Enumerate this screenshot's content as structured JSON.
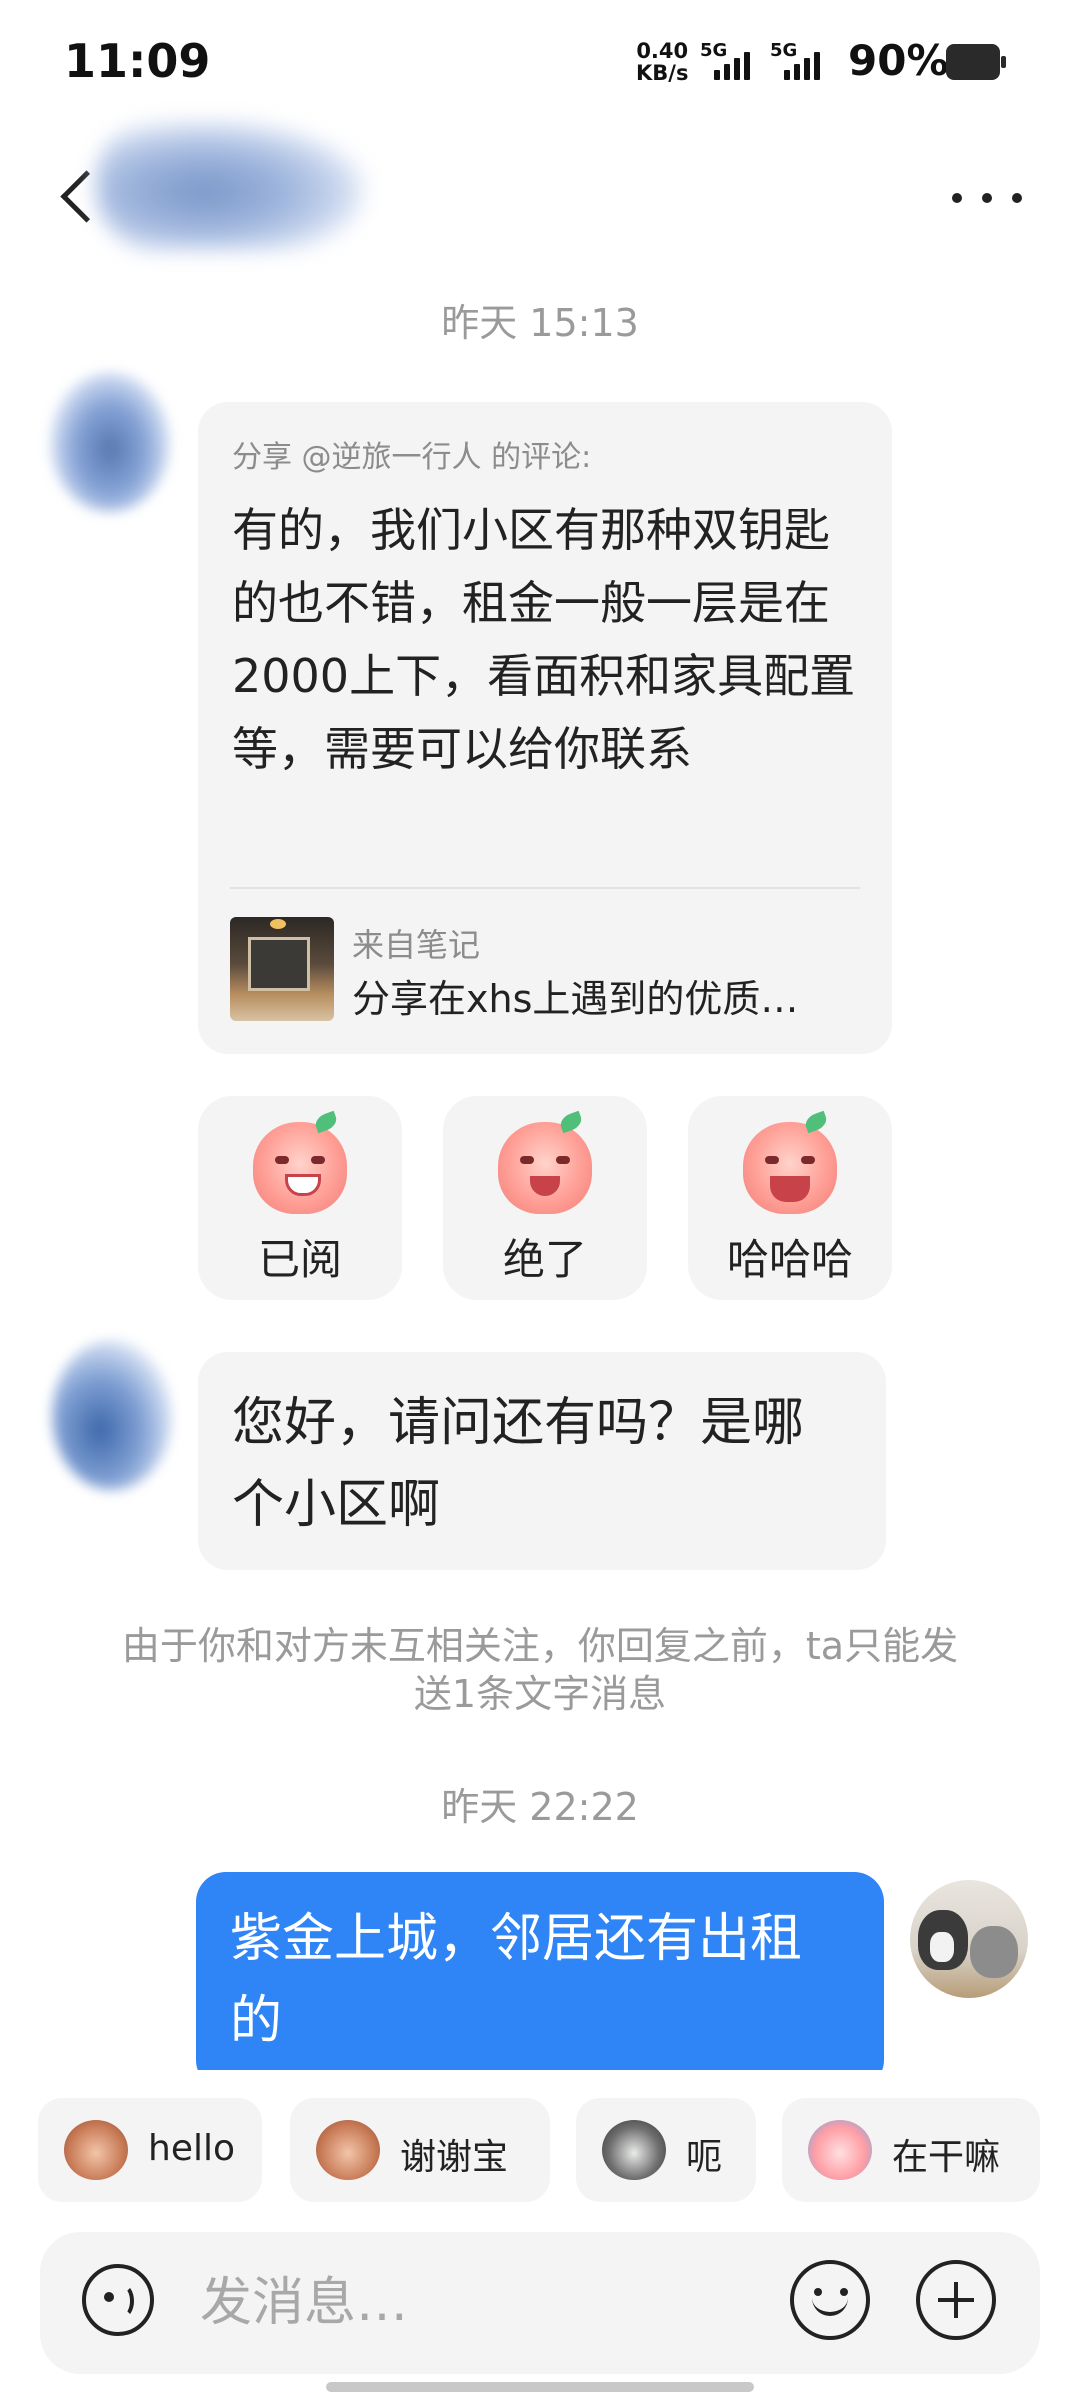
{
  "status_bar": {
    "time": "11:09",
    "net_speed_value": "0.40",
    "net_speed_unit": "KB/s",
    "signal1_label": "5G",
    "signal2_label": "5G",
    "battery_percent": "90%"
  },
  "header": {
    "back_icon": "chevron-left-icon",
    "more_icon": "more-horizontal-icon"
  },
  "messages": {
    "timestamp_1": "昨天 15:13",
    "share_card": {
      "header": "分享 @逆旅一行人 的评论:",
      "body": "有的，我们小区有那种双钥匙的也不错，租金一般一层是在2000上下，看面积和家具配置等，需要可以给你联系",
      "note_from": "来自笔记",
      "note_title": "分享在xhs上遇到的优质…"
    },
    "reactions": [
      {
        "label": "已阅"
      },
      {
        "label": "绝了"
      },
      {
        "label": "哈哈哈"
      }
    ],
    "incoming_text": "您好，请问还有吗？是哪个小区啊",
    "notice": "由于你和对方未互相关注，你回复之前，ta只能发送1条文字消息",
    "timestamp_2": "昨天 22:22",
    "outgoing_text": "紫金上城，邻居还有出租的"
  },
  "quick_replies": [
    {
      "label": "hello",
      "icon": "monkey-icon"
    },
    {
      "label": "谢谢宝",
      "icon": "monkey-flower-icon"
    },
    {
      "label": "呃",
      "icon": "cat-icon"
    },
    {
      "label": "在干嘛",
      "icon": "peach-magnifier-icon"
    }
  ],
  "composer": {
    "placeholder": "发消息…",
    "voice_icon": "voice-icon",
    "emoji_icon": "emoji-icon",
    "plus_icon": "plus-icon"
  },
  "colors": {
    "accent_blue": "#2f84f6",
    "bubble_gray": "#f4f4f4",
    "muted_text": "#9a9a9a"
  }
}
